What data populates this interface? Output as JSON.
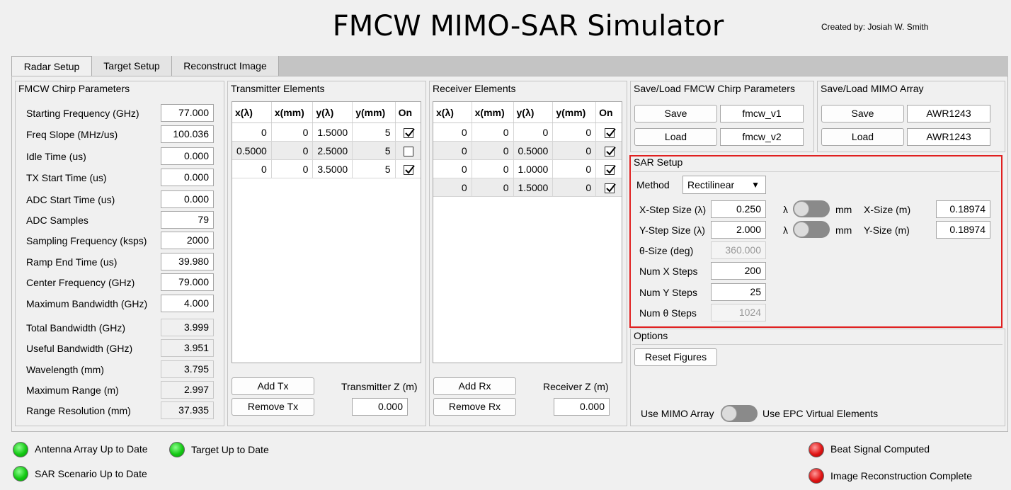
{
  "app": {
    "title": "FMCW MIMO-SAR Simulator",
    "creator": "Created by: Josiah W. Smith"
  },
  "tabs": [
    {
      "label": "Radar Setup",
      "active": true
    },
    {
      "label": "Target Setup",
      "active": false
    },
    {
      "label": "Reconstruct Image",
      "active": false
    }
  ],
  "chirp": {
    "title": "FMCW Chirp Parameters",
    "params": [
      {
        "label": "Starting Frequency (GHz)",
        "value": "77.000",
        "editable": true
      },
      {
        "label": "Freq Slope (MHz/us)",
        "value": "100.036",
        "editable": true
      },
      {
        "label": "Idle Time (us)",
        "value": "0.000",
        "editable": true
      },
      {
        "label": "TX Start Time (us)",
        "value": "0.000",
        "editable": true
      },
      {
        "label": "ADC Start Time (us)",
        "value": "0.000",
        "editable": true
      },
      {
        "label": "ADC Samples",
        "value": "79",
        "editable": true
      },
      {
        "label": "Sampling Frequency (ksps)",
        "value": "2000",
        "editable": true
      },
      {
        "label": "Ramp End Time (us)",
        "value": "39.980",
        "editable": true
      },
      {
        "label": "Center Frequency (GHz)",
        "value": "79.000",
        "editable": true
      },
      {
        "label": "Maximum Bandwidth (GHz)",
        "value": "4.000",
        "editable": true
      },
      {
        "label": "Total Bandwidth (GHz)",
        "value": "3.999",
        "editable": false
      },
      {
        "label": "Useful Bandwidth (GHz)",
        "value": "3.951",
        "editable": false
      },
      {
        "label": "Wavelength (mm)",
        "value": "3.795",
        "editable": false
      },
      {
        "label": "Maximum Range (m)",
        "value": "2.997",
        "editable": false
      },
      {
        "label": "Range Resolution (mm)",
        "value": "37.935",
        "editable": false
      }
    ]
  },
  "tx": {
    "title": "Transmitter Elements",
    "columns": [
      "x(λ)",
      "x(mm)",
      "y(λ)",
      "y(mm)",
      "On"
    ],
    "rows": [
      {
        "xl": "0",
        "xmm": "0",
        "yl": "1.5000",
        "ymm": "5",
        "on": true
      },
      {
        "xl": "0.5000",
        "xmm": "0",
        "yl": "2.5000",
        "ymm": "5",
        "on": false
      },
      {
        "xl": "0",
        "xmm": "0",
        "yl": "3.5000",
        "ymm": "5",
        "on": true
      }
    ],
    "add_label": "Add Tx",
    "remove_label": "Remove Tx",
    "z_label": "Transmitter Z (m)",
    "z_value": "0.000"
  },
  "rx": {
    "title": "Receiver Elements",
    "columns": [
      "x(λ)",
      "x(mm)",
      "y(λ)",
      "y(mm)",
      "On"
    ],
    "rows": [
      {
        "xl": "0",
        "xmm": "0",
        "yl": "0",
        "ymm": "0",
        "on": true
      },
      {
        "xl": "0",
        "xmm": "0",
        "yl": "0.5000",
        "ymm": "0",
        "on": true
      },
      {
        "xl": "0",
        "xmm": "0",
        "yl": "1.0000",
        "ymm": "0",
        "on": true
      },
      {
        "xl": "0",
        "xmm": "0",
        "yl": "1.5000",
        "ymm": "0",
        "on": true
      }
    ],
    "add_label": "Add Rx",
    "remove_label": "Remove Rx",
    "z_label": "Receiver Z (m)",
    "z_value": "0.000"
  },
  "saveload_chirp": {
    "title": "Save/Load FMCW Chirp Parameters",
    "save_label": "Save",
    "save_value": "fmcw_v1",
    "load_label": "Load",
    "load_value": "fmcw_v2"
  },
  "saveload_mimo": {
    "title": "Save/Load MIMO Array",
    "save_label": "Save",
    "save_value": "AWR1243",
    "load_label": "Load",
    "load_value": "AWR1243"
  },
  "sar": {
    "title": "SAR Setup",
    "method_label": "Method",
    "method_value": "Rectilinear",
    "x_step_label": "X-Step Size (λ)",
    "x_step_value": "0.250",
    "y_step_label": "Y-Step Size (λ)",
    "y_step_value": "2.000",
    "toggle_left": "λ",
    "toggle_right": "mm",
    "x_size_label": "X-Size (m)",
    "x_size_value": "0.18974",
    "y_size_label": "Y-Size (m)",
    "y_size_value": "0.18974",
    "theta_size_label": "θ-Size (deg)",
    "theta_size_value": "360.000",
    "num_x_label": "Num X Steps",
    "num_x_value": "200",
    "num_y_label": "Num Y Steps",
    "num_y_value": "25",
    "num_theta_label": "Num θ Steps",
    "num_theta_value": "1024",
    "highlight_color": "#e02020"
  },
  "options": {
    "title": "Options",
    "reset_label": "Reset Figures",
    "mimo_left": "Use MIMO Array",
    "mimo_right": "Use EPC Virtual Elements"
  },
  "status": {
    "antenna": "Antenna Array Up to Date",
    "target": "Target Up to Date",
    "sar": "SAR Scenario Up to Date",
    "beat": "Beat Signal Computed",
    "recon": "Image Reconstruction Complete",
    "green_color": "#14c814",
    "red_color": "#e01414"
  }
}
